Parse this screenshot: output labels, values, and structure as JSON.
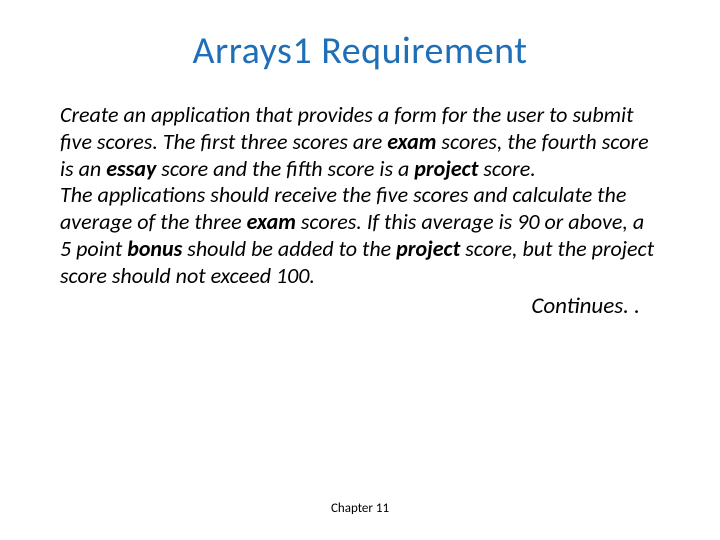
{
  "title": "Arrays1 Requirement",
  "para1": {
    "t1": "Create an application that provides a form for the user to submit five scores.  The first three scores are ",
    "b1": "exam",
    "t2": " scores, the fourth score is an ",
    "b2": "essay",
    "t3": " score and the fifth score is a ",
    "b3": "project",
    "t4": " score."
  },
  "para2": {
    "t1": "The applications should receive the five scores and calculate the average of the three ",
    "b1": "exam",
    "t2": " scores. If this average is 90 or above, a 5 point ",
    "b2": "bonus",
    "t3": " should be added to the ",
    "b3": "project",
    "t4": " score, but the project score should not exceed 100."
  },
  "continues": "Continues. .",
  "footer": "Chapter 11"
}
